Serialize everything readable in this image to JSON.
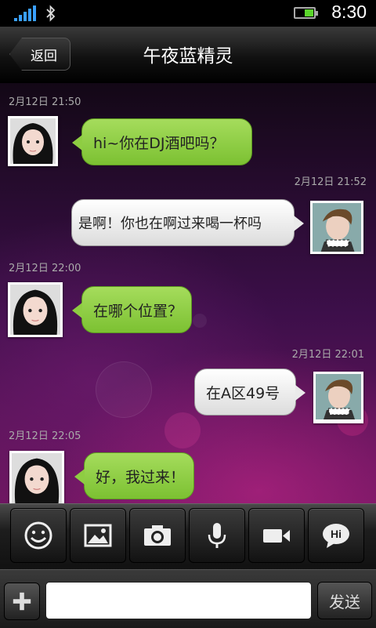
{
  "status_bar": {
    "time": "8:30",
    "icons": [
      "signal-icon",
      "bluetooth-icon",
      "battery-icon"
    ]
  },
  "header": {
    "back_label": "返回",
    "title": "午夜蓝精灵"
  },
  "messages": [
    {
      "timestamp": "2月12日  21:50",
      "side": "left",
      "text": "hi~你在DJ酒吧吗？"
    },
    {
      "timestamp": "2月12日  21:52",
      "side": "right",
      "text": "是啊！你也在啊过来喝一杯吗"
    },
    {
      "timestamp": "2月12日  22:00",
      "side": "left",
      "text": "在哪个位置？"
    },
    {
      "timestamp": "2月12日  22:01",
      "side": "right",
      "text": "在A区49号"
    },
    {
      "timestamp": "2月12日  22:05",
      "side": "left",
      "text": "好，我过来！"
    }
  ],
  "toolbar": {
    "buttons": [
      "emoji-icon",
      "image-icon",
      "camera-icon",
      "microphone-icon",
      "video-icon",
      "hi-icon"
    ],
    "hi_text": "Hi"
  },
  "input_bar": {
    "plus_label": "+",
    "input_value": "",
    "send_label": "发送"
  },
  "colors": {
    "bubble_green": "#8ecd42",
    "bubble_white": "#f0f0f0",
    "background_purple": "#5a1358"
  }
}
